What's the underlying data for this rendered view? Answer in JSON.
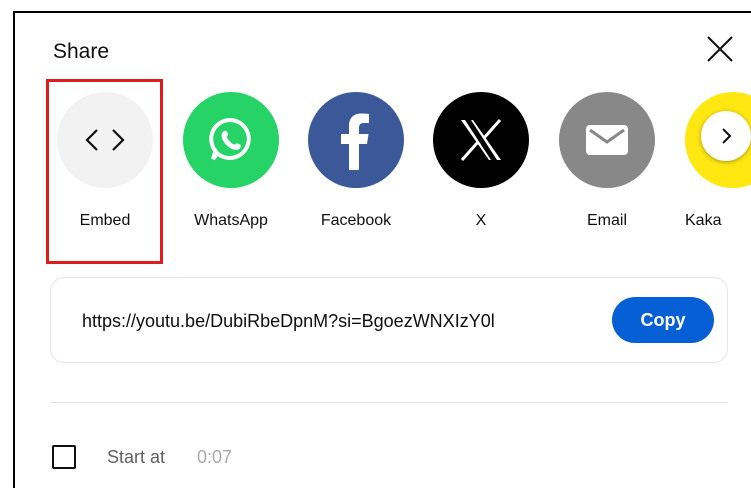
{
  "dialog": {
    "title": "Share",
    "close_icon": "close-icon"
  },
  "share_targets": [
    {
      "label": "Embed",
      "icon": "embed-icon",
      "color": "#f2f2f2"
    },
    {
      "label": "WhatsApp",
      "icon": "whatsapp-icon",
      "color": "#25d366"
    },
    {
      "label": "Facebook",
      "icon": "facebook-icon",
      "color": "#3b5998"
    },
    {
      "label": "X",
      "icon": "x-icon",
      "color": "#000000"
    },
    {
      "label": "Email",
      "icon": "email-icon",
      "color": "#888888"
    },
    {
      "label": "Kaka",
      "icon": "kakaotalk-icon",
      "color": "#ffe812"
    }
  ],
  "next_button_icon": "chevron-right-icon",
  "link": {
    "url": "https://youtu.be/DubiRbeDpnM?si=BgoezWNXIzY0l",
    "copy_label": "Copy",
    "copy_color": "#065fd4"
  },
  "start_at": {
    "label": "Start at",
    "time": "0:07",
    "checked": false
  },
  "highlight_color": "#e01b1b"
}
